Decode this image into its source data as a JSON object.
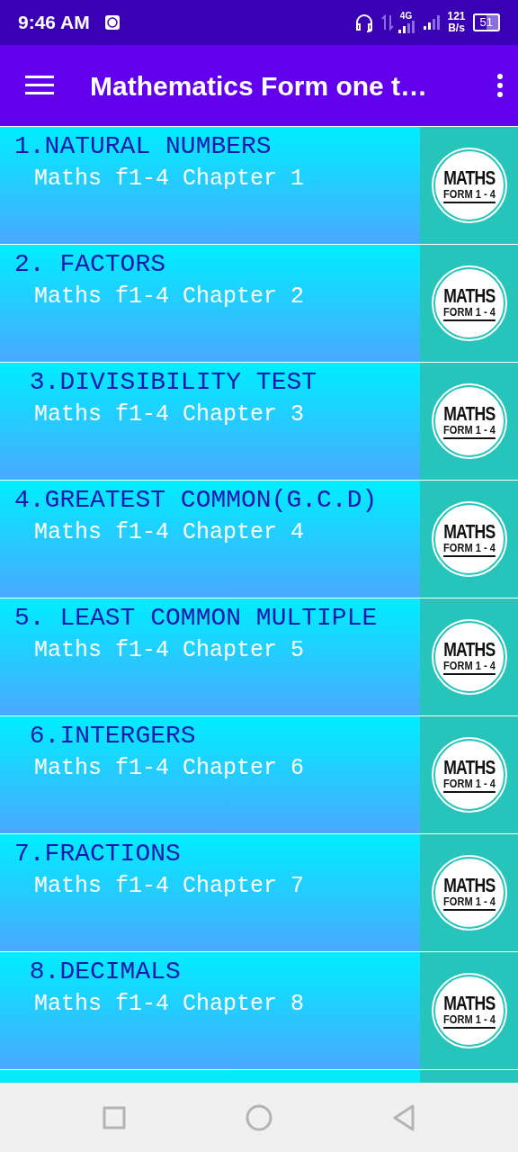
{
  "status_bar": {
    "time": "9:46 AM",
    "network": "4G",
    "speed": "121",
    "speed_unit": "B/s",
    "battery": "51"
  },
  "app_bar": {
    "title": "Mathematics Form one t…"
  },
  "chapters": [
    {
      "title": "1.NATURAL NUMBERS",
      "subtitle": "Maths f1-4 Chapter 1",
      "logo": [
        "MATHS",
        "FORM 1 - 4"
      ]
    },
    {
      "title": "2. FACTORS",
      "subtitle": "Maths f1-4 Chapter 2",
      "logo": [
        "MATHS",
        "FORM 1 - 4"
      ]
    },
    {
      "title": " 3.DIVISIBILITY TEST",
      "subtitle": "Maths f1-4 Chapter 3",
      "logo": [
        "MATHS",
        "FORM 1 - 4"
      ]
    },
    {
      "title": "4.GREATEST COMMON(G.C.D)",
      "subtitle": "Maths f1-4 Chapter 4",
      "logo": [
        "MATHS",
        "FORM 1 - 4"
      ]
    },
    {
      "title": "5. LEAST COMMON MULTIPLE",
      "subtitle": "Maths f1-4 Chapter 5",
      "logo": [
        "MATHS",
        "FORM 1 - 4"
      ]
    },
    {
      "title": " 6.INTERGERS",
      "subtitle": "Maths f1-4 Chapter 6",
      "logo": [
        "MATHS",
        "FORM 1 - 4"
      ]
    },
    {
      "title": "7.FRACTIONS",
      "subtitle": "Maths f1-4 Chapter 7",
      "logo": [
        "MATHS",
        "FORM 1 - 4"
      ]
    },
    {
      "title": " 8.DECIMALS",
      "subtitle": "Maths f1-4 Chapter 8",
      "logo": [
        "MATHS",
        "FORM 1 - 4"
      ]
    }
  ]
}
